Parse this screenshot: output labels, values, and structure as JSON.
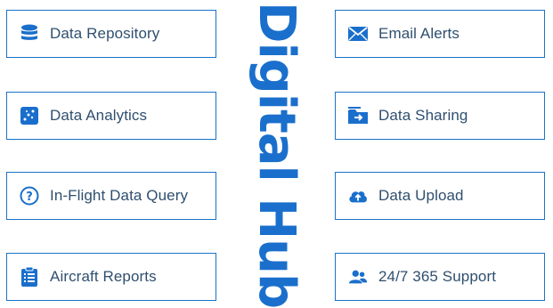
{
  "title": "Digital Hub",
  "colors": {
    "accent": "#1a73c6",
    "text": "#2f4f6f",
    "title": "#1a6fcc"
  },
  "tiles_left": [
    {
      "label": "Data Repository",
      "icon": "database-icon"
    },
    {
      "label": "Data Analytics",
      "icon": "analytics-icon"
    },
    {
      "label": "In-Flight Data Query",
      "icon": "question-circle-icon"
    },
    {
      "label": "Aircraft Reports",
      "icon": "clipboard-list-icon"
    }
  ],
  "tiles_right": [
    {
      "label": "Email Alerts",
      "icon": "envelope-icon"
    },
    {
      "label": "Data Sharing",
      "icon": "folder-share-icon"
    },
    {
      "label": "Data Upload",
      "icon": "cloud-upload-icon"
    },
    {
      "label": "24/7 365 Support",
      "icon": "users-icon"
    }
  ]
}
